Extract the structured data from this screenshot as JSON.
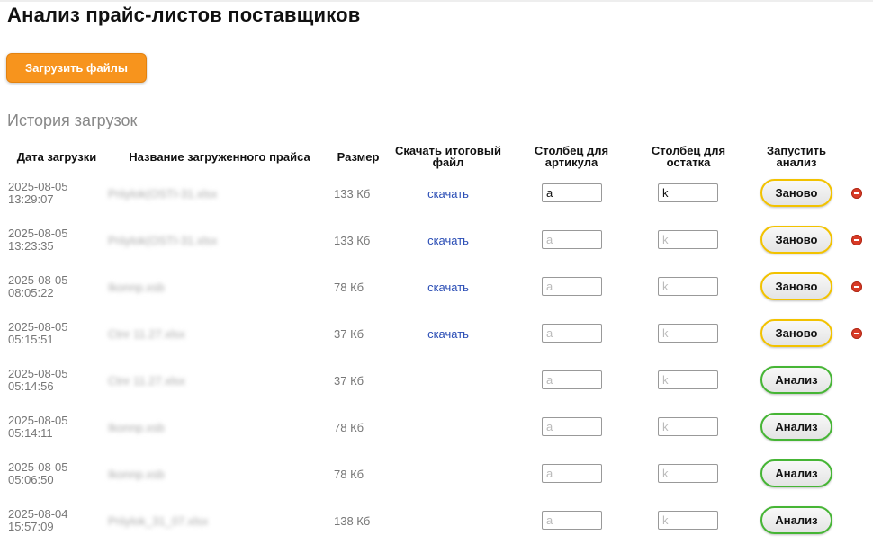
{
  "page": {
    "title": "Анализ прайс-листов поставщиков",
    "upload_button": "Загрузить файлы",
    "history_title": "История загрузок"
  },
  "table": {
    "headers": {
      "date": "Дата загрузки",
      "name": "Название загруженного прайса",
      "size": "Размер",
      "download": "Скачать итоговый файл",
      "article_col": "Столбец для артикула",
      "stock_col": "Столбец для остатка",
      "run": "Запустить анализ"
    },
    "rows": [
      {
        "date": "2025-08-05",
        "time": "13:29:07",
        "name": "Priiylok(OSTI-31.xlsx",
        "size": "133 Кб",
        "download": "скачать",
        "article_value": "a",
        "article_placeholder": "a",
        "stock_value": "k",
        "stock_placeholder": "k",
        "action": "Заново",
        "action_type": "redo",
        "deletable": true
      },
      {
        "date": "2025-08-05",
        "time": "13:23:35",
        "name": "Priiylok(OSTI-31.xlsx",
        "size": "133 Кб",
        "download": "скачать",
        "article_value": "",
        "article_placeholder": "a",
        "stock_value": "",
        "stock_placeholder": "k",
        "action": "Заново",
        "action_type": "redo",
        "deletable": true
      },
      {
        "date": "2025-08-05",
        "time": "08:05:22",
        "name": "Ikonnp.xsb",
        "size": "78 Кб",
        "download": "скачать",
        "article_value": "",
        "article_placeholder": "a",
        "stock_value": "",
        "stock_placeholder": "k",
        "action": "Заново",
        "action_type": "redo",
        "deletable": true
      },
      {
        "date": "2025-08-05",
        "time": "05:15:51",
        "name": "Ctnr 11.27.xlsx",
        "size": "37 Кб",
        "download": "скачать",
        "article_value": "",
        "article_placeholder": "a",
        "stock_value": "",
        "stock_placeholder": "k",
        "action": "Заново",
        "action_type": "redo",
        "deletable": true
      },
      {
        "date": "2025-08-05",
        "time": "05:14:56",
        "name": "Ctnr 11.27.xlsx",
        "size": "37 Кб",
        "download": "",
        "article_value": "",
        "article_placeholder": "a",
        "stock_value": "",
        "stock_placeholder": "k",
        "action": "Анализ",
        "action_type": "run",
        "deletable": false
      },
      {
        "date": "2025-08-05",
        "time": "05:14:11",
        "name": "Ikonnp.xsb",
        "size": "78 Кб",
        "download": "",
        "article_value": "",
        "article_placeholder": "a",
        "stock_value": "",
        "stock_placeholder": "k",
        "action": "Анализ",
        "action_type": "run",
        "deletable": false
      },
      {
        "date": "2025-08-05",
        "time": "05:06:50",
        "name": "Ikonnp.xsb",
        "size": "78 Кб",
        "download": "",
        "article_value": "",
        "article_placeholder": "a",
        "stock_value": "",
        "stock_placeholder": "k",
        "action": "Анализ",
        "action_type": "run",
        "deletable": false
      },
      {
        "date": "2025-08-04",
        "time": "15:57:09",
        "name": "Priiylok_31_07.xlsx",
        "size": "138 Кб",
        "download": "",
        "article_value": "",
        "article_placeholder": "a",
        "stock_value": "",
        "stock_placeholder": "k",
        "action": "Анализ",
        "action_type": "run",
        "deletable": false
      }
    ]
  },
  "colors": {
    "upload_button": "#f7941d",
    "redo_border": "#f2c200",
    "run_border": "#46b535",
    "delete_icon": "#d93a26",
    "link": "#2a4db5"
  }
}
